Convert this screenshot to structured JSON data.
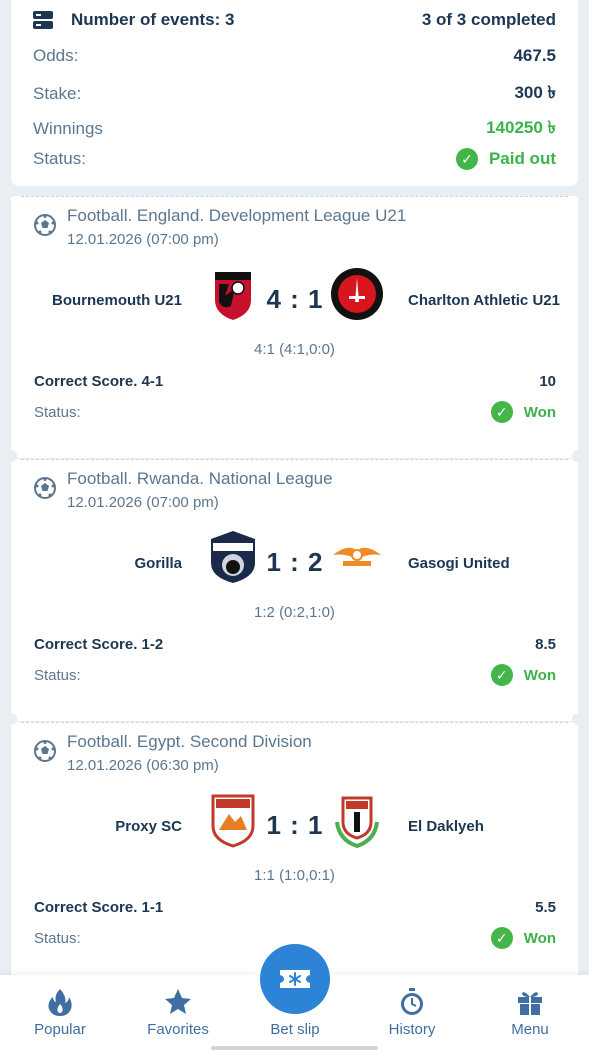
{
  "summary": {
    "events_label": "Number of events: 3",
    "completed": "3 of 3 completed",
    "odds_label": "Odds:",
    "odds_value": "467.5",
    "stake_label": "Stake:",
    "stake_value": "300 ৳",
    "winnings_label": "Winnings",
    "winnings_value": "140250 ৳",
    "status_label": "Status:",
    "status_value": "Paid out"
  },
  "events": [
    {
      "league": "Football. England. Development League U21",
      "date": "12.01.2026 (07:00 pm)",
      "home": "Bournemouth U21",
      "away": "Charlton Athletic U21",
      "score": "4 : 1",
      "detail": "4:1 (4:1,0:0)",
      "bet": "Correct Score. 4-1",
      "odds": "10",
      "status_label": "Status:",
      "status": "Won"
    },
    {
      "league": "Football. Rwanda. National League",
      "date": "12.01.2026 (07:00 pm)",
      "home": "Gorilla",
      "away": "Gasogi United",
      "score": "1 : 2",
      "detail": "1:2 (0:2,1:0)",
      "bet": "Correct Score. 1-2",
      "odds": "8.5",
      "status_label": "Status:",
      "status": "Won"
    },
    {
      "league": "Football. Egypt. Second Division",
      "date": "12.01.2026 (06:30 pm)",
      "home": "Proxy SC",
      "away": "El Daklyeh",
      "score": "1 : 1",
      "detail": "1:1 (1:0,0:1)",
      "bet": "Correct Score. 1-1",
      "odds": "5.5",
      "status_label": "Status:",
      "status": "Won"
    }
  ],
  "nav": {
    "popular": "Popular",
    "favorites": "Favorites",
    "betslip": "Bet slip",
    "history": "History",
    "menu": "Menu"
  },
  "colors": {
    "accent": "#2d83d6",
    "won": "#3bb24a",
    "text": "#1d3652",
    "muted": "#5c7690"
  }
}
